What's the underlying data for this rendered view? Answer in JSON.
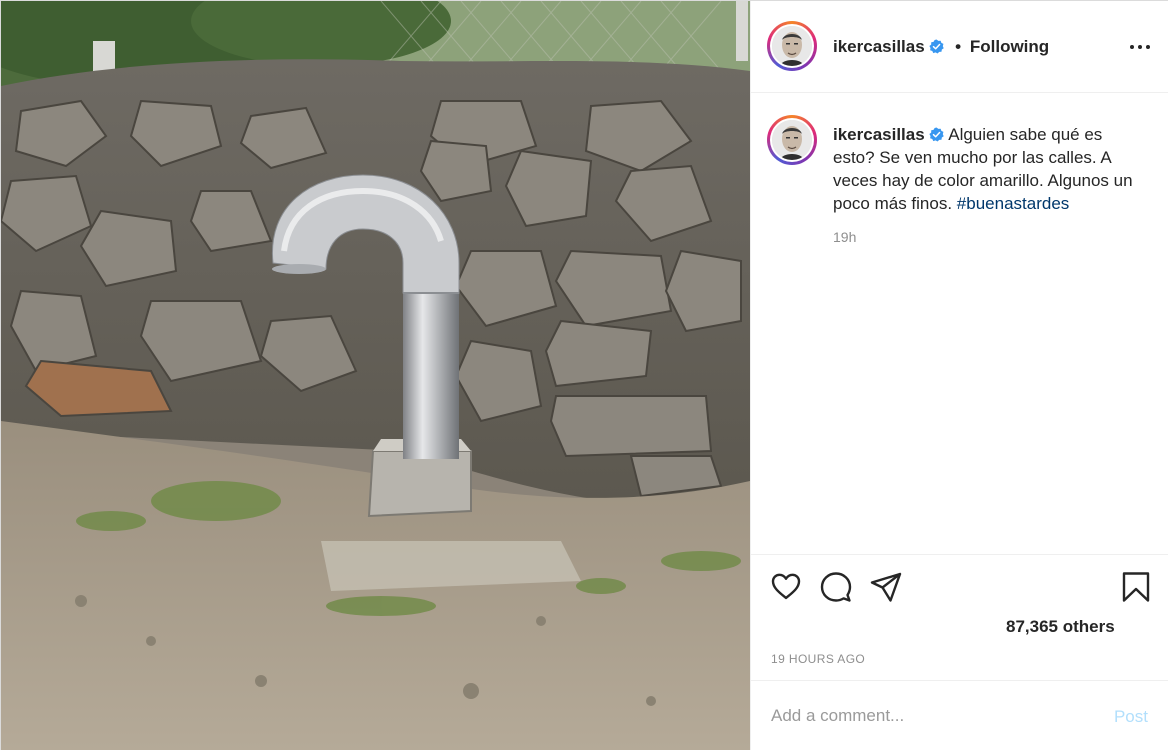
{
  "post": {
    "author": {
      "username": "ikercasillas",
      "verified": true,
      "avatar_icon": "profile-photo"
    },
    "follow_status": "Following",
    "separator": "•",
    "caption": {
      "text": "Alguien sabe qué es esto? Se ven mucho por las calles. A veces hay de color amarillo. Algunos un poco más finos.",
      "hashtag": "#buenastardes",
      "time_ago": "19h"
    },
    "likes_text": "87,365 others",
    "timestamp": "19 HOURS AGO",
    "comment": {
      "placeholder": "Add a comment...",
      "value": "",
      "post_label": "Post"
    },
    "icons": {
      "like": "heart-icon",
      "comment": "comment-icon",
      "share": "paper-plane-icon",
      "save": "bookmark-icon",
      "more": "more-horizontal-icon",
      "verified": "verified-badge-icon"
    },
    "colors": {
      "verified_blue": "#3897f0",
      "hashtag": "#00376b",
      "post_disabled": "#b2dffc",
      "muted": "#8e8e8e"
    }
  }
}
